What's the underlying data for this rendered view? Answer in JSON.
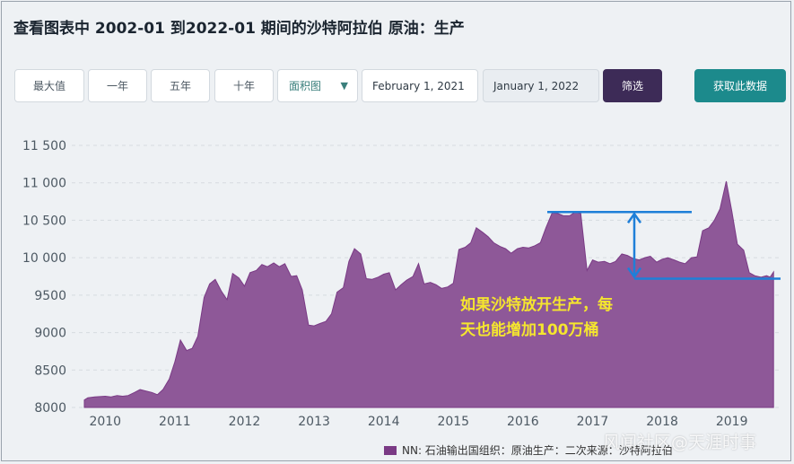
{
  "title": "查看图表中 2002-01 到2022-01 期间的沙特阿拉伯 原油：生产",
  "controls": {
    "btn_max": "最大值",
    "btn_1y": "一年",
    "btn_5y": "五年",
    "btn_10y": "十年",
    "chart_type": "面积图",
    "date_from": "February 1, 2021",
    "date_to": "January 1, 2022",
    "filter": "筛选",
    "get_data": "获取此数据"
  },
  "legend": "NN: 石油输出国组织：原油生产：二次来源：沙特阿拉伯",
  "annotation": {
    "line1": "如果沙特放开生产，每",
    "line2": "天也能增加100万桶"
  },
  "watermark": "风闻社区@天涯时事",
  "colors": {
    "area_fill": "#8e5898",
    "area_stroke": "#7a3a85",
    "annotation_lines": "#1e7fd8",
    "annotation_text": "#f5e62e"
  },
  "chart_data": {
    "type": "area",
    "x_ticks": [
      "2010",
      "2011",
      "2012",
      "2013",
      "2014",
      "2015",
      "2016",
      "2017",
      "2018",
      "2019"
    ],
    "y_ticks": [
      "11 500",
      "11 000",
      "10 500",
      "10 000",
      "9500",
      "9000",
      "8500",
      "8000"
    ],
    "ylim": [
      8000,
      11500
    ],
    "xlim": [
      2009.7,
      2019.6
    ],
    "grid": true,
    "legend_position": "bottom",
    "series": [
      {
        "name": "NN: 石油输出国组织：原油生产：二次来源：沙特阿拉伯",
        "x": [
          2009.7,
          2009.75,
          2009.85,
          2010.0,
          2010.08,
          2010.17,
          2010.25,
          2010.33,
          2010.42,
          2010.5,
          2010.58,
          2010.67,
          2010.75,
          2010.83,
          2010.92,
          2011.0,
          2011.08,
          2011.17,
          2011.25,
          2011.33,
          2011.42,
          2011.5,
          2011.58,
          2011.67,
          2011.75,
          2011.83,
          2011.92,
          2012.0,
          2012.08,
          2012.17,
          2012.25,
          2012.33,
          2012.42,
          2012.5,
          2012.58,
          2012.67,
          2012.75,
          2012.83,
          2012.92,
          2013.0,
          2013.08,
          2013.17,
          2013.25,
          2013.33,
          2013.42,
          2013.5,
          2013.58,
          2013.67,
          2013.75,
          2013.83,
          2013.92,
          2014.0,
          2014.08,
          2014.17,
          2014.25,
          2014.33,
          2014.42,
          2014.5,
          2014.58,
          2014.67,
          2014.75,
          2014.83,
          2014.92,
          2015.0,
          2015.08,
          2015.17,
          2015.25,
          2015.33,
          2015.42,
          2015.5,
          2015.58,
          2015.67,
          2015.75,
          2015.83,
          2015.92,
          2016.0,
          2016.08,
          2016.17,
          2016.25,
          2016.33,
          2016.42,
          2016.5,
          2016.58,
          2016.67,
          2016.75,
          2016.83,
          2016.92,
          2017.0,
          2017.08,
          2017.17,
          2017.25,
          2017.33,
          2017.42,
          2017.5,
          2017.58,
          2017.67,
          2017.75,
          2017.83,
          2017.92,
          2018.0,
          2018.08,
          2018.17,
          2018.25,
          2018.33,
          2018.42,
          2018.5,
          2018.58,
          2018.67,
          2018.75,
          2018.83,
          2018.92,
          2019.0,
          2019.08,
          2019.17,
          2019.25,
          2019.33,
          2019.42,
          2019.5,
          2019.55,
          2019.6
        ],
        "values": [
          8100,
          8130,
          8140,
          8150,
          8140,
          8160,
          8150,
          8160,
          8200,
          8240,
          8220,
          8200,
          8170,
          8240,
          8380,
          8610,
          8900,
          8760,
          8790,
          8950,
          9470,
          9650,
          9710,
          9550,
          9440,
          9790,
          9730,
          9620,
          9800,
          9830,
          9910,
          9880,
          9930,
          9880,
          9920,
          9750,
          9760,
          9570,
          9100,
          9090,
          9120,
          9150,
          9250,
          9540,
          9600,
          9950,
          10120,
          10050,
          9720,
          9710,
          9740,
          9780,
          9800,
          9570,
          9640,
          9700,
          9750,
          9920,
          9650,
          9670,
          9640,
          9590,
          9610,
          9660,
          10110,
          10140,
          10200,
          10400,
          10340,
          10280,
          10200,
          10150,
          10120,
          10060,
          10120,
          10140,
          10130,
          10160,
          10200,
          10400,
          10600,
          10590,
          10560,
          10560,
          10610,
          10590,
          9830,
          9970,
          9940,
          9950,
          9920,
          9950,
          10050,
          10030,
          9990,
          9970,
          10000,
          10020,
          9940,
          9980,
          10000,
          9970,
          9940,
          9920,
          10000,
          10010,
          10360,
          10400,
          10500,
          10650,
          11020,
          10620,
          10180,
          10100,
          9800,
          9760,
          9740,
          9760,
          9740,
          9810
        ]
      }
    ]
  }
}
